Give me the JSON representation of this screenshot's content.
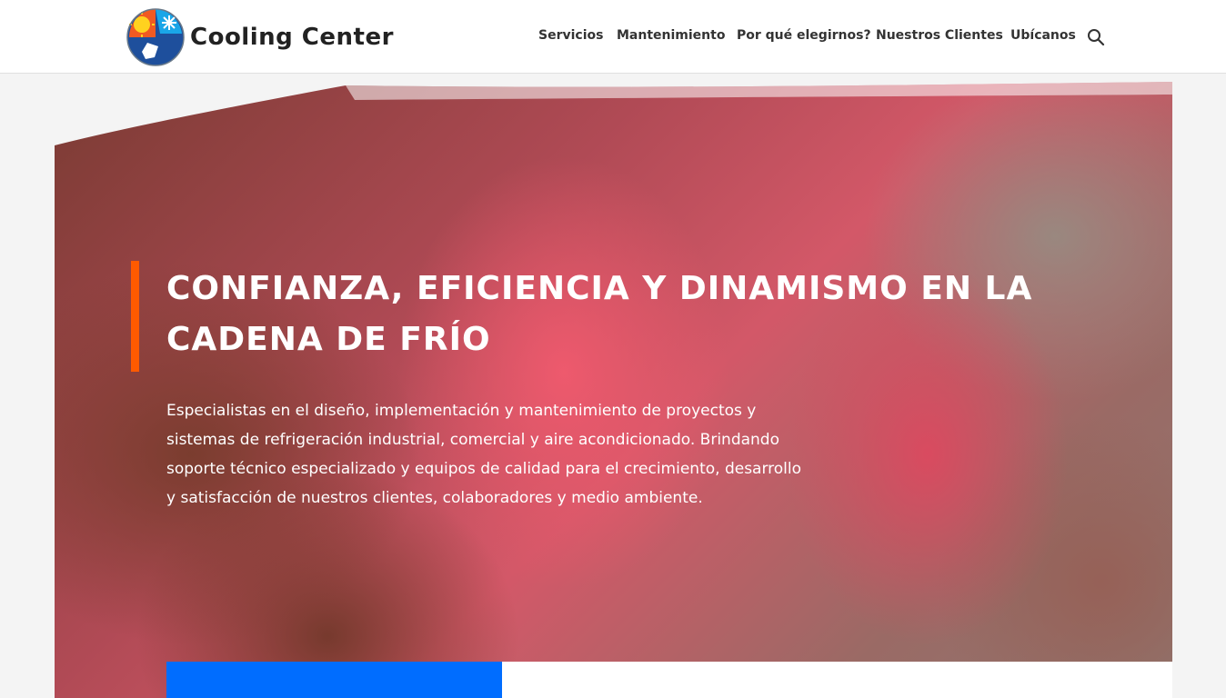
{
  "header": {
    "logo_text": "Cooling Center",
    "search_icon": "search-icon"
  },
  "nav": {
    "items": [
      {
        "label": "Servicios"
      },
      {
        "label": "Mantenimiento"
      },
      {
        "label": "Por qué elegirnos?"
      },
      {
        "label": "Nuestros Clientes"
      },
      {
        "label": "Ubícanos"
      }
    ]
  },
  "hero": {
    "title": "Confianza, eficiencia y dinamismo en la cadena de frío",
    "description": "Especialistas en el diseño, implementación y mantenimiento de proyectos y sistemas de refrigeración industrial, comercial y aire acondicionado. Brindando soporte técnico especializado y equipos de calidad para el crecimiento, desarrollo y satisfacción de nuestros clientes, colaboradores y medio ambiente."
  },
  "colors": {
    "accent": "#ff5a00",
    "blue": "#006dff",
    "header_bg": "#ffffff",
    "text_dark": "#333333"
  }
}
